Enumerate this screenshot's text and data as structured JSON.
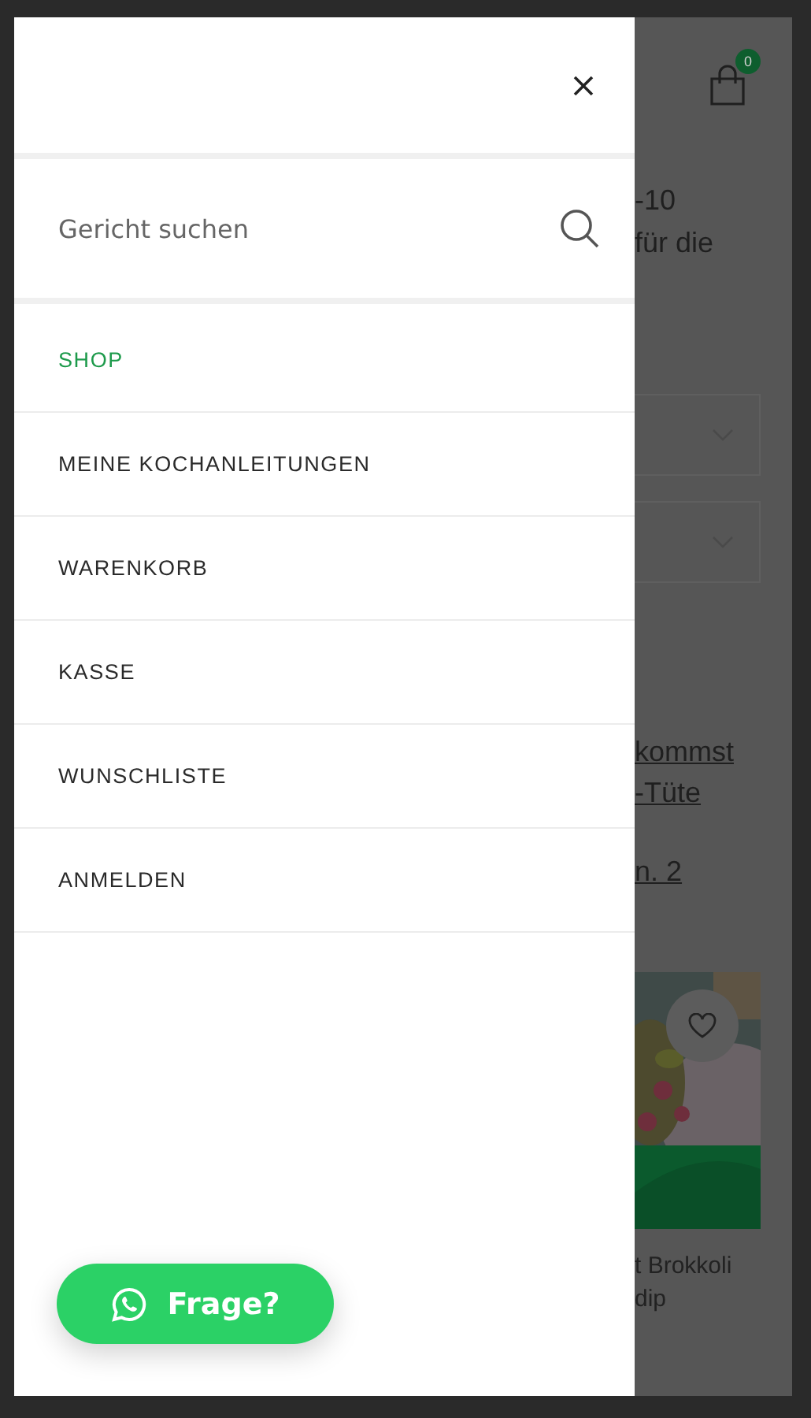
{
  "drawer": {
    "search": {
      "placeholder": "Gericht suchen"
    },
    "menu": [
      {
        "label": "SHOP",
        "selected": true
      },
      {
        "label": "MEINE KOCHANLEITUNGEN",
        "selected": false
      },
      {
        "label": "WARENKORB",
        "selected": false
      },
      {
        "label": "KASSE",
        "selected": false
      },
      {
        "label": "WUNSCHLISTE",
        "selected": false
      },
      {
        "label": "ANMELDEN",
        "selected": false
      }
    ],
    "chat_button": {
      "label": "Frage?"
    }
  },
  "background_page": {
    "cart_count": "0",
    "heading_lines": [
      "-10",
      "für die"
    ],
    "links": [
      "kommst",
      "-Tüte",
      "n. 2"
    ],
    "product": {
      "kind": "picture",
      "title_lines": [
        "t Brokkoli",
        "dip"
      ]
    }
  }
}
